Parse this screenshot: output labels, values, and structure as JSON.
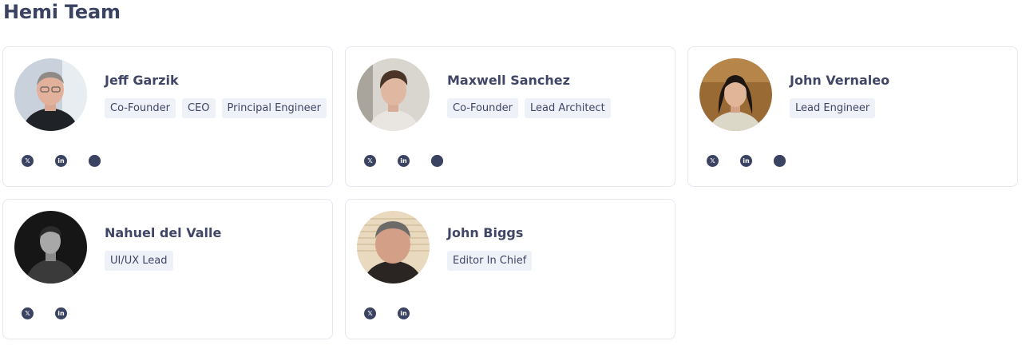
{
  "page": {
    "title": "Hemi Team"
  },
  "members": [
    {
      "name": "Jeff Garzik",
      "roles": [
        "Co-Founder",
        "CEO",
        "Principal Engineer"
      ],
      "socials": [
        "x-icon",
        "linkedin-icon",
        "github-icon"
      ]
    },
    {
      "name": "Maxwell Sanchez",
      "roles": [
        "Co-Founder",
        "Lead Architect"
      ],
      "socials": [
        "x-icon",
        "linkedin-icon",
        "github-icon"
      ]
    },
    {
      "name": "John Vernaleo",
      "roles": [
        "Lead Engineer"
      ],
      "socials": [
        "x-icon",
        "linkedin-icon",
        "github-icon"
      ]
    },
    {
      "name": "Nahuel del Valle",
      "roles": [
        "UI/UX Lead"
      ],
      "socials": [
        "x-icon",
        "linkedin-icon"
      ]
    },
    {
      "name": "John Biggs",
      "roles": [
        "Editor In Chief"
      ],
      "socials": [
        "x-icon",
        "linkedin-icon"
      ]
    }
  ],
  "colors": {
    "text": "#3f4666",
    "tag_bg": "#eef1f7",
    "card_border": "#e4e7ee",
    "icon": "#3b4362"
  }
}
